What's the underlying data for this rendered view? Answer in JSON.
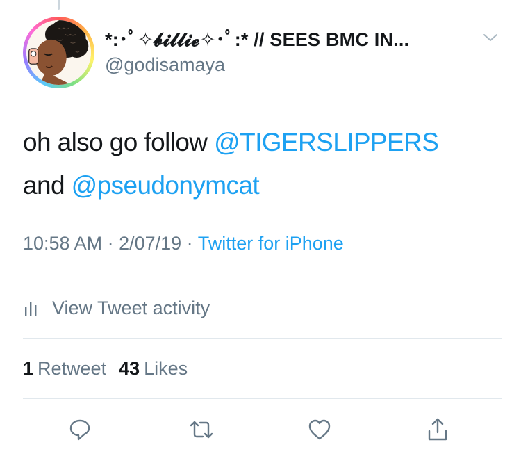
{
  "tweet": {
    "display_name": "*:･ﾟ✧𝓫𝓲𝓵𝓵𝓲𝓮✧･ﾟ:* // SEES BMC IN...",
    "handle": "@godisamaya",
    "text_prefix": "oh also go follow ",
    "mention_1": "@TIGERSLIPPERS",
    "text_middle": "and ",
    "mention_2": "@pseudonymcat",
    "time": "10:58 AM",
    "separator": " · ",
    "date": "2/07/19",
    "source": "Twitter for iPhone"
  },
  "activity": {
    "label": "View Tweet activity",
    "icon": "bar-chart-icon"
  },
  "stats": {
    "retweet_count": "1",
    "retweet_label": "Retweet",
    "like_count": "43",
    "like_label": "Likes"
  },
  "actions": [
    {
      "icon": "reply-icon"
    },
    {
      "icon": "retweet-icon"
    },
    {
      "icon": "like-icon"
    },
    {
      "icon": "share-icon"
    }
  ],
  "colors": {
    "link": "#1da1f2",
    "secondary": "#657786",
    "text": "#14171a",
    "divider": "#e1e8ed"
  }
}
